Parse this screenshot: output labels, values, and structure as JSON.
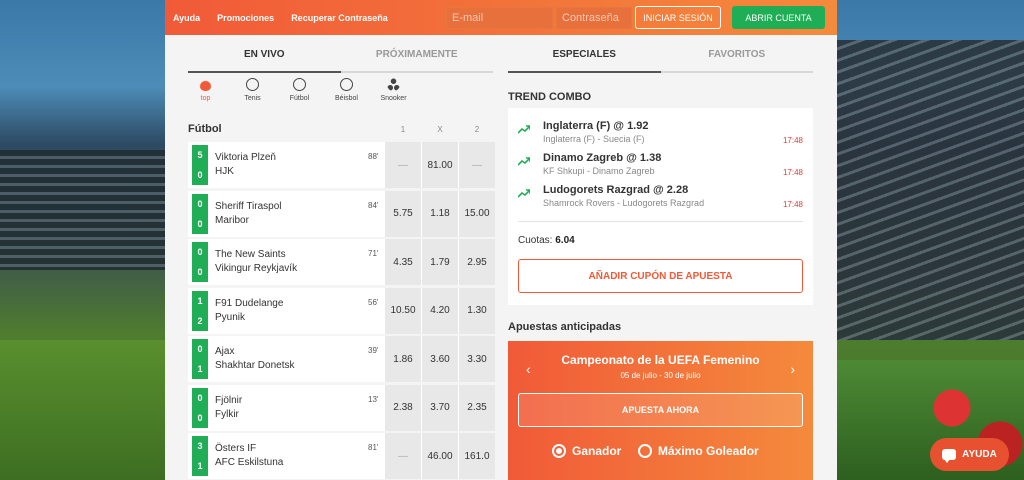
{
  "topbar": {
    "links": [
      "Ayuda",
      "Promociones",
      "Recuperar Contraseña"
    ],
    "email_placeholder": "E-mail",
    "password_placeholder": "Contraseña",
    "login_label": "INICIAR SESIÓN",
    "register_label": "ABRIR CUENTA"
  },
  "left_tabs": [
    "EN VIVO",
    "PRÓXIMAMENTE"
  ],
  "right_tabs": [
    "ESPECIALES",
    "FAVORITOS"
  ],
  "sports": [
    {
      "label": "top",
      "icon": "flame-icon"
    },
    {
      "label": "Tenis",
      "icon": "tennis-ball-icon"
    },
    {
      "label": "Fútbol",
      "icon": "soccer-ball-icon"
    },
    {
      "label": "Béisbol",
      "icon": "baseball-icon"
    },
    {
      "label": "Snooker",
      "icon": "snooker-balls-icon"
    }
  ],
  "list_header": {
    "title": "Fútbol",
    "col1": "1",
    "colx": "X",
    "col2": "2"
  },
  "matches": [
    {
      "home": "Viktoria Plzeň",
      "away": "HJK",
      "s1": "5",
      "s2": "0",
      "min": "88'",
      "o1": "—",
      "ox": "81.00",
      "o2": "—"
    },
    {
      "home": "Sheriff Tiraspol",
      "away": "Maribor",
      "s1": "0",
      "s2": "0",
      "min": "84'",
      "o1": "5.75",
      "ox": "1.18",
      "o2": "15.00"
    },
    {
      "home": "The New Saints",
      "away": "Vikingur Reykjavík",
      "s1": "0",
      "s2": "0",
      "min": "71'",
      "o1": "4.35",
      "ox": "1.79",
      "o2": "2.95"
    },
    {
      "home": "F91 Dudelange",
      "away": "Pyunik",
      "s1": "1",
      "s2": "2",
      "min": "56'",
      "o1": "10.50",
      "ox": "4.20",
      "o2": "1.30"
    },
    {
      "home": "Ajax",
      "away": "Shakhtar Donetsk",
      "s1": "0",
      "s2": "1",
      "min": "39'",
      "o1": "1.86",
      "ox": "3.60",
      "o2": "3.30"
    },
    {
      "home": "Fjölnir",
      "away": "Fylkir",
      "s1": "0",
      "s2": "0",
      "min": "13'",
      "o1": "2.38",
      "ox": "3.70",
      "o2": "2.35"
    },
    {
      "home": "Östers IF",
      "away": "AFC Eskilstuna",
      "s1": "3",
      "s2": "1",
      "min": "81'",
      "o1": "—",
      "ox": "46.00",
      "o2": "161.0"
    }
  ],
  "combo": {
    "title": "TREND COMBO",
    "items": [
      {
        "selection": "Inglaterra (F) @ 1.92",
        "event": "Inglaterra (F) - Suecia (F)",
        "time": "17:48"
      },
      {
        "selection": "Dinamo Zagreb @ 1.38",
        "event": "KF Shkupi - Dinamo Zagreb",
        "time": "17:48"
      },
      {
        "selection": "Ludogorets Razgrad @ 2.28",
        "event": "Shamrock Rovers - Ludogorets Razgrad",
        "time": "17:48"
      }
    ],
    "odds_label": "Cuotas:",
    "odds_value": "6.04",
    "add_button": "AÑADIR CUPÓN DE APUESTA"
  },
  "anticipadas": {
    "title": "Apuestas anticipadas",
    "promo_title": "Campeonato de la UEFA Femenino",
    "promo_dates": "05 de julio - 30 de julio",
    "bet_button": "APUESTA AHORA",
    "option1": "Ganador",
    "option2": "Máximo Goleador"
  },
  "help_label": "AYUDA",
  "colors": {
    "accent": "#f15a38",
    "green": "#1fae55",
    "time_red": "#e03b3b"
  }
}
